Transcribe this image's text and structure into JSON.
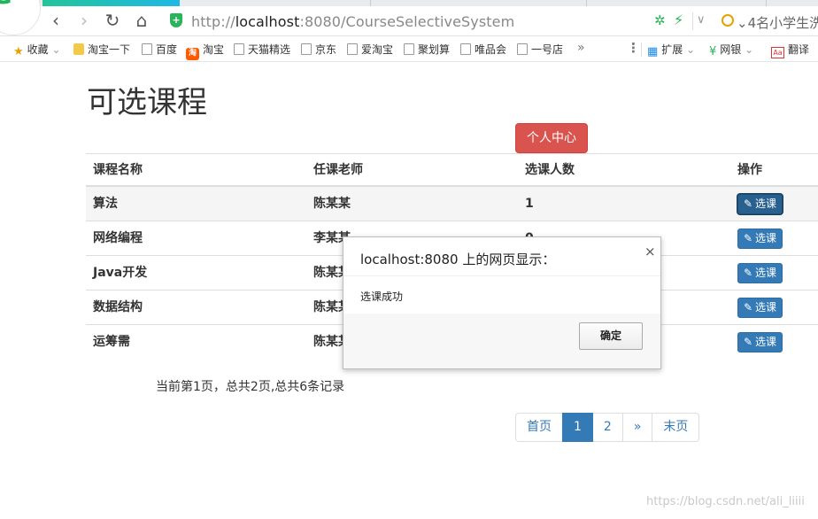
{
  "browser": {
    "url_prefix": "http://",
    "url_host": "localhost",
    "url_rest": ":8080/CourseSelectiveSystem/Cou",
    "search_text": "⌄4名小学生洗",
    "bookmarks": [
      "收藏",
      "淘宝一下",
      "百度",
      "淘宝",
      "天猫精选",
      "京东",
      "爱淘宝",
      "聚划算",
      "唯品会",
      "一号店"
    ],
    "bookmarks_right": [
      "扩展",
      "网银",
      "翻译"
    ]
  },
  "page": {
    "title": "可选课程",
    "personal_center": "个人中心",
    "table": {
      "headers": [
        "课程名称",
        "任课老师",
        "选课人数",
        "操作"
      ],
      "rows": [
        {
          "course": "算法",
          "teacher": "陈某某",
          "count": "1"
        },
        {
          "course": "网络编程",
          "teacher": "李某某",
          "count": "0"
        },
        {
          "course": "Java开发",
          "teacher": "陈某某",
          "count": ""
        },
        {
          "course": "数据结构",
          "teacher": "陈某某",
          "count": ""
        },
        {
          "course": "运筹需",
          "teacher": "陈某某",
          "count": ""
        }
      ],
      "action_label": "选课"
    },
    "pager_info": "当前第1页，总共2页,总共6条记录",
    "pagination": {
      "first": "首页",
      "p1": "1",
      "p2": "2",
      "next": "»",
      "last": "末页"
    },
    "watermark": "https://blog.csdn.net/ali_liiii"
  },
  "dialog": {
    "title": "localhost:8080 上的网页显示：",
    "message": "选课成功",
    "ok": "确定",
    "close": "×"
  }
}
